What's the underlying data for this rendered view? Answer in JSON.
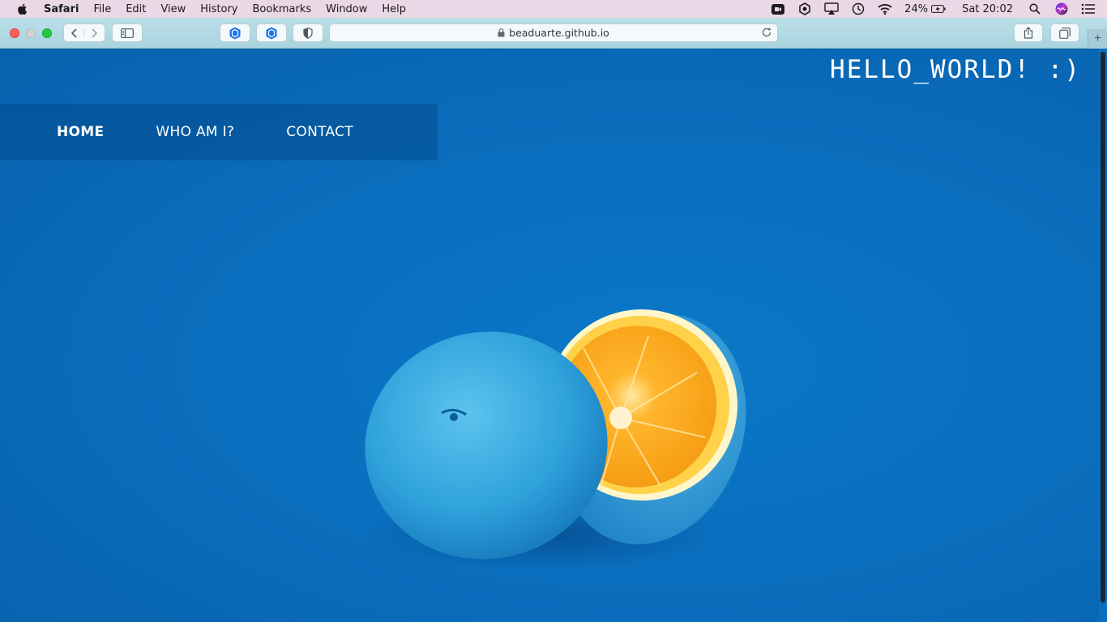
{
  "menubar": {
    "app_name": "Safari",
    "items": [
      "File",
      "Edit",
      "View",
      "History",
      "Bookmarks",
      "Window",
      "Help"
    ],
    "battery": "24%",
    "clock": "Sat 20:02"
  },
  "browser": {
    "url": "beaduarte.github.io"
  },
  "site": {
    "title": "HELLO_WORLD! :)",
    "nav": [
      "HOME",
      "WHO AM I?",
      "CONTACT"
    ],
    "active_nav": "HOME",
    "hero_image": "blue-painted-orange-cut-in-half",
    "background_color": "#0a6fbf"
  },
  "icons": {
    "apple": "apple-logo-icon",
    "facetime": "camera-icon",
    "airplay": "airplay-icon",
    "time_machine": "time-machine-icon",
    "wifi": "wifi-icon",
    "battery": "battery-charging-icon",
    "search": "spotlight-search-icon",
    "siri": "siri-icon",
    "control": "notification-center-icon"
  }
}
